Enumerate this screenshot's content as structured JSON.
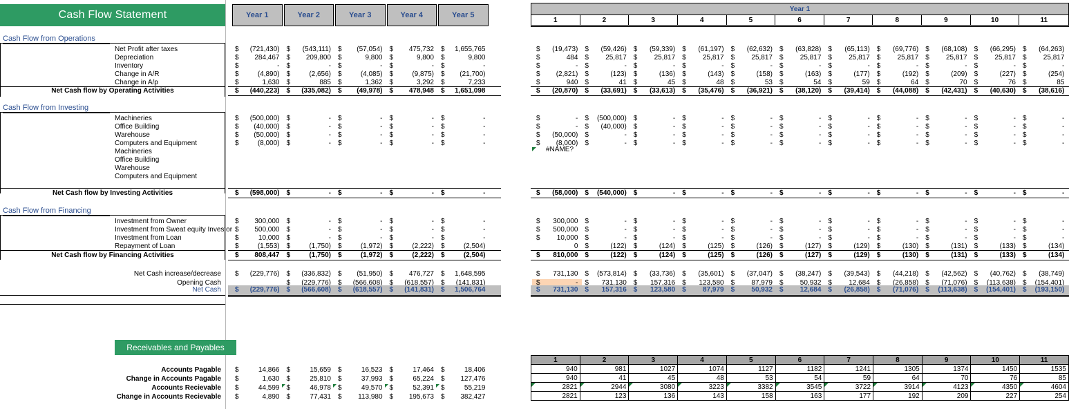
{
  "titles": {
    "main": "Cash Flow Statement",
    "receivables": "Receivables and Payables"
  },
  "left_table": {
    "year_headers": [
      "Year 1",
      "Year 2",
      "Year 3",
      "Year 4",
      "Year 5"
    ]
  },
  "right_table": {
    "group_header": "Year 1",
    "month_headers": [
      "1",
      "2",
      "3",
      "4",
      "5",
      "6",
      "7",
      "8",
      "9",
      "10",
      "11"
    ]
  },
  "sections": {
    "operations": {
      "header": "Cash Flow from Operations",
      "total_label": "Net Cash flow by Operating Activities",
      "rows": [
        {
          "label": "Net Profit after taxes",
          "years": [
            "(721,430)",
            "(543,111)",
            "(57,054)",
            "475,732",
            "1,655,765"
          ],
          "months": [
            "(19,473)",
            "(59,426)",
            "(59,339)",
            "(61,197)",
            "(62,632)",
            "(63,828)",
            "(65,113)",
            "(69,776)",
            "(68,108)",
            "(66,295)",
            "(64,263)"
          ]
        },
        {
          "label": "Depreciation",
          "years": [
            "284,467",
            "209,800",
            "9,800",
            "9,800",
            "9,800"
          ],
          "months": [
            "484",
            "25,817",
            "25,817",
            "25,817",
            "25,817",
            "25,817",
            "25,817",
            "25,817",
            "25,817",
            "25,817",
            "25,817"
          ]
        },
        {
          "label": "Inventory",
          "years": [
            "-",
            "-",
            "-",
            "-",
            "-"
          ],
          "months": [
            "-",
            "-",
            "-",
            "-",
            "-",
            "-",
            "-",
            "-",
            "-",
            "-",
            "-"
          ]
        },
        {
          "label": "Change in A/R",
          "years": [
            "(4,890)",
            "(2,656)",
            "(4,085)",
            "(9,875)",
            "(21,700)"
          ],
          "months": [
            "(2,821)",
            "(123)",
            "(136)",
            "(143)",
            "(158)",
            "(163)",
            "(177)",
            "(192)",
            "(209)",
            "(227)",
            "(254)"
          ]
        },
        {
          "label": "Change in A/p",
          "years": [
            "1,630",
            "885",
            "1,362",
            "3,292",
            "7,233"
          ],
          "months": [
            "940",
            "41",
            "45",
            "48",
            "53",
            "54",
            "59",
            "64",
            "70",
            "76",
            "85"
          ]
        }
      ],
      "total_years": [
        "(440,223)",
        "(335,082)",
        "(49,978)",
        "478,948",
        "1,651,098"
      ],
      "total_months": [
        "(20,870)",
        "(33,691)",
        "(33,613)",
        "(35,476)",
        "(36,921)",
        "(38,120)",
        "(39,414)",
        "(44,088)",
        "(42,431)",
        "(40,630)",
        "(38,616)"
      ]
    },
    "investing": {
      "header": "Cash Flow from Investing",
      "total_label": "Net Cash flow by Investing Activities",
      "rows": [
        {
          "label": "Machineries",
          "years": [
            "(500,000)",
            "-",
            "-",
            "-",
            "-"
          ],
          "months": [
            "-",
            "(500,000)",
            "-",
            "-",
            "-",
            "-",
            "-",
            "-",
            "-",
            "-",
            "-"
          ]
        },
        {
          "label": "Office Building",
          "years": [
            "(40,000)",
            "-",
            "-",
            "-",
            "-"
          ],
          "months": [
            "-",
            "(40,000)",
            "-",
            "-",
            "-",
            "-",
            "-",
            "-",
            "-",
            "-",
            "-"
          ]
        },
        {
          "label": "Warehouse",
          "years": [
            "(50,000)",
            "-",
            "-",
            "-",
            "-"
          ],
          "months": [
            "(50,000)",
            "-",
            "-",
            "-",
            "-",
            "-",
            "-",
            "-",
            "-",
            "-",
            "-"
          ]
        },
        {
          "label": "Computers and Equipment",
          "years": [
            "(8,000)",
            "-",
            "-",
            "-",
            "-"
          ],
          "months": [
            "(8,000)",
            "-",
            "-",
            "-",
            "-",
            "-",
            "-",
            "-",
            "-",
            "-",
            "-"
          ]
        },
        {
          "label": "Machineries",
          "years": [],
          "months": []
        },
        {
          "label": "Office Building",
          "years": [],
          "months": []
        },
        {
          "label": "Warehouse",
          "years": [],
          "months": []
        },
        {
          "label": "Computers and Equipment",
          "years": [],
          "months": []
        }
      ],
      "error_value": "#NAME?",
      "total_years": [
        "(598,000)",
        "-",
        "-",
        "-",
        "-"
      ],
      "total_months": [
        "(58,000)",
        "(540,000)",
        "-",
        "-",
        "-",
        "-",
        "-",
        "-",
        "-",
        "-",
        "-"
      ]
    },
    "financing": {
      "header": "Cash Flow from Financing",
      "total_label": "Net Cash flow by Financing Activities",
      "rows": [
        {
          "label": "Investment from Owner",
          "years": [
            "300,000",
            "-",
            "-",
            "-",
            "-"
          ],
          "months": [
            "300,000",
            "-",
            "-",
            "-",
            "-",
            "-",
            "-",
            "-",
            "-",
            "-",
            "-"
          ]
        },
        {
          "label": "Investment from Sweat equity Investor",
          "years": [
            "500,000",
            "-",
            "-",
            "-",
            "-"
          ],
          "months": [
            "500,000",
            "-",
            "-",
            "-",
            "-",
            "-",
            "-",
            "-",
            "-",
            "-",
            "-"
          ]
        },
        {
          "label": "Investment from Loan",
          "years": [
            "10,000",
            "-",
            "-",
            "-",
            "-"
          ],
          "months": [
            "10,000",
            "-",
            "-",
            "-",
            "-",
            "-",
            "-",
            "-",
            "-",
            "-",
            "-"
          ]
        },
        {
          "label": "Repayment of Loan",
          "years": [
            "(1,553)",
            "(1,750)",
            "(1,972)",
            "(2,222)",
            "(2,504)"
          ],
          "months": [
            "0",
            "(122)",
            "(124)",
            "(125)",
            "(126)",
            "(127)",
            "(129)",
            "(130)",
            "(131)",
            "(133)",
            "(134)"
          ]
        }
      ],
      "total_years": [
        "808,447",
        "(1,750)",
        "(1,972)",
        "(2,222)",
        "(2,504)"
      ],
      "total_months": [
        "810,000",
        "(122)",
        "(124)",
        "(125)",
        "(126)",
        "(127)",
        "(129)",
        "(130)",
        "(131)",
        "(133)",
        "(134)"
      ]
    },
    "summary": {
      "rows": [
        {
          "label": "Net Cash increase/decrease",
          "years": [
            "(229,776)",
            "(336,832)",
            "(51,950)",
            "476,727",
            "1,648,595"
          ],
          "months": [
            "731,130",
            "(573,814)",
            "(33,736)",
            "(35,601)",
            "(37,047)",
            "(38,247)",
            "(39,543)",
            "(44,218)",
            "(42,562)",
            "(40,762)",
            "(38,749)"
          ]
        },
        {
          "label": "Opening Cash",
          "years": [
            "",
            "(229,776)",
            "(566,608)",
            "(618,557)",
            "(141,831)"
          ],
          "months": [
            "-",
            "731,130",
            "157,316",
            "123,580",
            "87,979",
            "50,932",
            "12,684",
            "(26,858)",
            "(71,076)",
            "(113,638)",
            "(154,401)"
          ]
        }
      ],
      "net_cash_label": "Net Cash",
      "net_cash_years": [
        "(229,776)",
        "(566,608)",
        "(618,557)",
        "(141,831)",
        "1,506,764"
      ],
      "net_cash_months": [
        "731,130",
        "157,316",
        "123,580",
        "87,979",
        "50,932",
        "12,684",
        "(26,858)",
        "(71,076)",
        "(113,638)",
        "(154,401)",
        "(193,150)"
      ]
    }
  },
  "receivables_payables": {
    "rows": [
      {
        "label": "Accounts Pagable",
        "years": [
          "14,866",
          "15,659",
          "16,523",
          "17,464",
          "18,406"
        ],
        "months": [
          "940",
          "981",
          "1027",
          "1074",
          "1127",
          "1182",
          "1241",
          "1305",
          "1374",
          "1450",
          "1535"
        ],
        "flag": false
      },
      {
        "label": "Change in Accounts Pagable",
        "years": [
          "1,630",
          "25,810",
          "37,993",
          "65,224",
          "127,476"
        ],
        "months": [
          "940",
          "41",
          "45",
          "48",
          "53",
          "54",
          "59",
          "64",
          "70",
          "76",
          "85"
        ],
        "flag": false
      },
      {
        "label": "Accounts Recievable",
        "years": [
          "44,599",
          "46,978",
          "49,570",
          "52,391",
          "55,219"
        ],
        "months": [
          "2821",
          "2944",
          "3080",
          "3223",
          "3382",
          "3545",
          "3722",
          "3914",
          "4123",
          "4350",
          "4604"
        ],
        "flag": true
      },
      {
        "label": "Change in Accounts Recievable",
        "years": [
          "4,890",
          "77,431",
          "113,980",
          "195,673",
          "382,427"
        ],
        "months": [
          "2821",
          "123",
          "136",
          "143",
          "158",
          "163",
          "177",
          "192",
          "209",
          "227",
          "254"
        ],
        "flag": false
      }
    ],
    "month_headers": [
      "1",
      "2",
      "3",
      "4",
      "5",
      "6",
      "7",
      "8",
      "9",
      "10",
      "11"
    ]
  },
  "colors": {
    "banner_green": "#2e9b63",
    "header_gray": "#bfbfbf",
    "accent_blue": "#2a4d8f",
    "highlight_peach": "#fcd5b4",
    "error_flag_green": "#1e7d3c"
  },
  "currency_symbol": "$"
}
